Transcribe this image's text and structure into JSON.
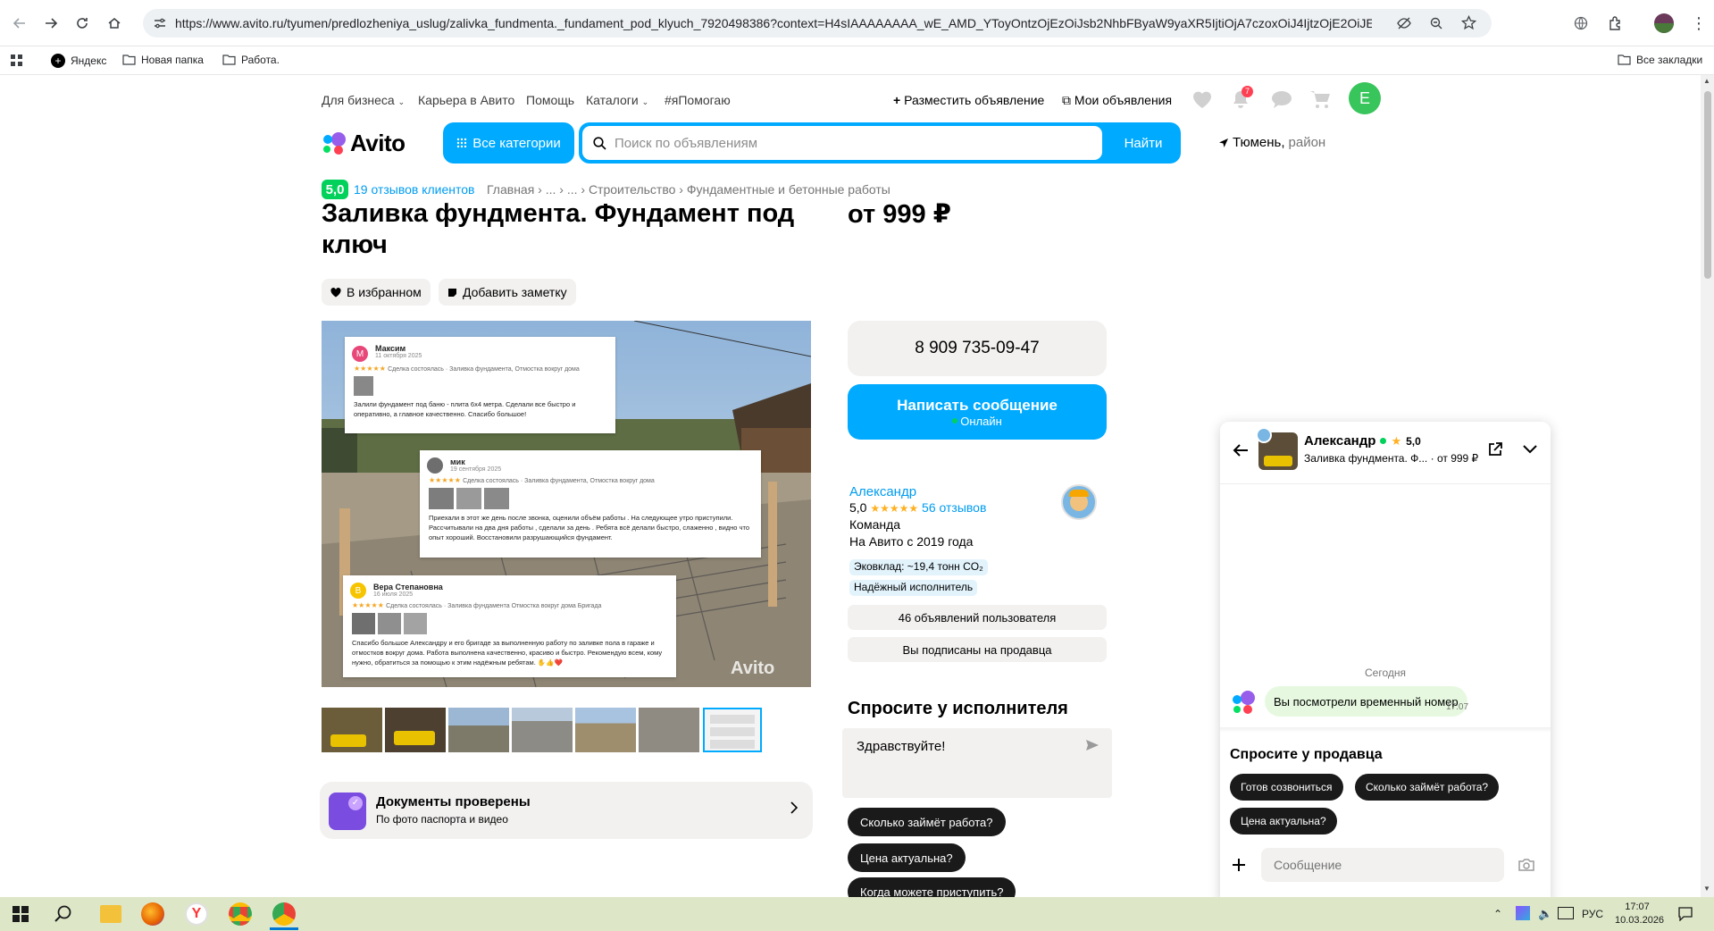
{
  "browser": {
    "url": "https://www.avito.ru/tyumen/predlozheniya_uslug/zalivka_fundmenta._fundament_pod_klyuch_7920498386?context=H4sIAAAAAAAA_wE_AMD_YToyOntzOjEzOiJsb2NhbFByaW9yaXR5IjtiOjA7czoxOiJ4IjtzOjE2OiJENFdsZnhneGl2bXph...",
    "profile_letter": "",
    "bookmarks": [
      "Яндекс",
      "Новая папка",
      "Работа."
    ],
    "all_bookmarks_label": "Все закладки"
  },
  "topnav": {
    "business": "Для бизнеса",
    "career": "Карьера в Авито",
    "help": "Помощь",
    "catalogs": "Каталоги",
    "helping": "#яПомогаю",
    "post_ad": "Разместить объявление",
    "my_ads": "Мои объявления",
    "notif_count": "7",
    "avatar_letter": "E"
  },
  "header": {
    "logo": "Avito",
    "all_categories": "Все категории",
    "search_placeholder": "Поиск по объявлениям",
    "search_button": "Найти",
    "location": "Тюмень,",
    "location_area": "район"
  },
  "listing": {
    "rating": "5,0",
    "reviews_link": "19 отзывов клиентов",
    "breadcrumb": "Главная › ... › ... › Строительство › Фундаментные и бетонные работы",
    "title": "Заливка фундмента. Фундамент под ключ",
    "price": "от 999 ₽",
    "favorite": "В избранном",
    "add_note": "Добавить заметку",
    "photo_watermark": "Avito",
    "reviews_in_photo": [
      {
        "initial": "М",
        "name": "Максим",
        "date": "11 октября 2025",
        "sub": "Сделка состоялась · Заливка фундамента, Отмостка вокруг дома",
        "text": "Залили фундамент под баню - плита 6х4 метра. Сделали все быстро и оперативно, а главное качественно. Спасибо большое!"
      },
      {
        "initial": "",
        "name": "мик",
        "date": "19 сентября 2025",
        "sub": "Сделка состоялась · Заливка фундамента, Отмостка вокруг дома",
        "text": "Приехали в этот же день после звонка, оценили объём работы . На следующее утро приступили. Рассчитывали на два дня работы , сделали за день . Ребята всё делали быстро, слаженно , видно что опыт хороший. Восстановили разрушающийся фундамент."
      },
      {
        "initial": "В",
        "name": "Вера Степановна",
        "date": "16 июля 2025",
        "sub": "Сделка состоялась · Заливка фундамента Отмостка вокруг дома Бригада",
        "text": "Спасибо большое Александру и его бригаде за выполненную работу по заливке пола в гараже и отмостков вокруг дома. Работа выполнена качественно, красиво и быстро. Рекомендую всем, кому нужно, обратиться за помощью к этим надёжным ребятам. ✋👍❤️"
      }
    ],
    "docs_title": "Документы проверены",
    "docs_subtitle": "По фото паспорта и видео"
  },
  "contact": {
    "phone": "8 909 735-09-47",
    "write_button": "Написать сообщение",
    "online": "Онлайн",
    "seller_name": "Александр",
    "seller_rating": "5,0",
    "seller_reviews": "56 отзывов",
    "seller_type": "Команда",
    "seller_since": "На Авито с 2019 года",
    "eco_tag": "Эковклад: ~19,4 тонн CO₂",
    "reliable_tag": "Надёжный исполнитель",
    "user_ads": "46 объявлений пользователя",
    "subscribed": "Вы подписаны на продавца",
    "ask_title": "Спросите у исполнителя",
    "ask_text": "Здравствуйте!",
    "chips": [
      "Сколько займёт работа?",
      "Цена актуальна?",
      "Когда можете приступить?"
    ]
  },
  "chat": {
    "name": "Александр",
    "rating": "5,0",
    "item": "Заливка фундмента. Ф...",
    "item_price": "· от 999 ₽",
    "today": "Сегодня",
    "message": "Вы посмотрели временный номер",
    "message_time": "17:07",
    "ask_title": "Спросите у продавца",
    "chips": [
      "Готов созвониться",
      "Сколько займёт работа?",
      "Цена актуальна?"
    ],
    "input_placeholder": "Сообщение"
  },
  "taskbar": {
    "lang": "РУС",
    "time": "17:07",
    "date": "10.03.2026"
  },
  "colors": {
    "accent": "#00aaff",
    "green": "#02d15c",
    "link": "#009cf0",
    "taskbar": "#dde7c7"
  }
}
